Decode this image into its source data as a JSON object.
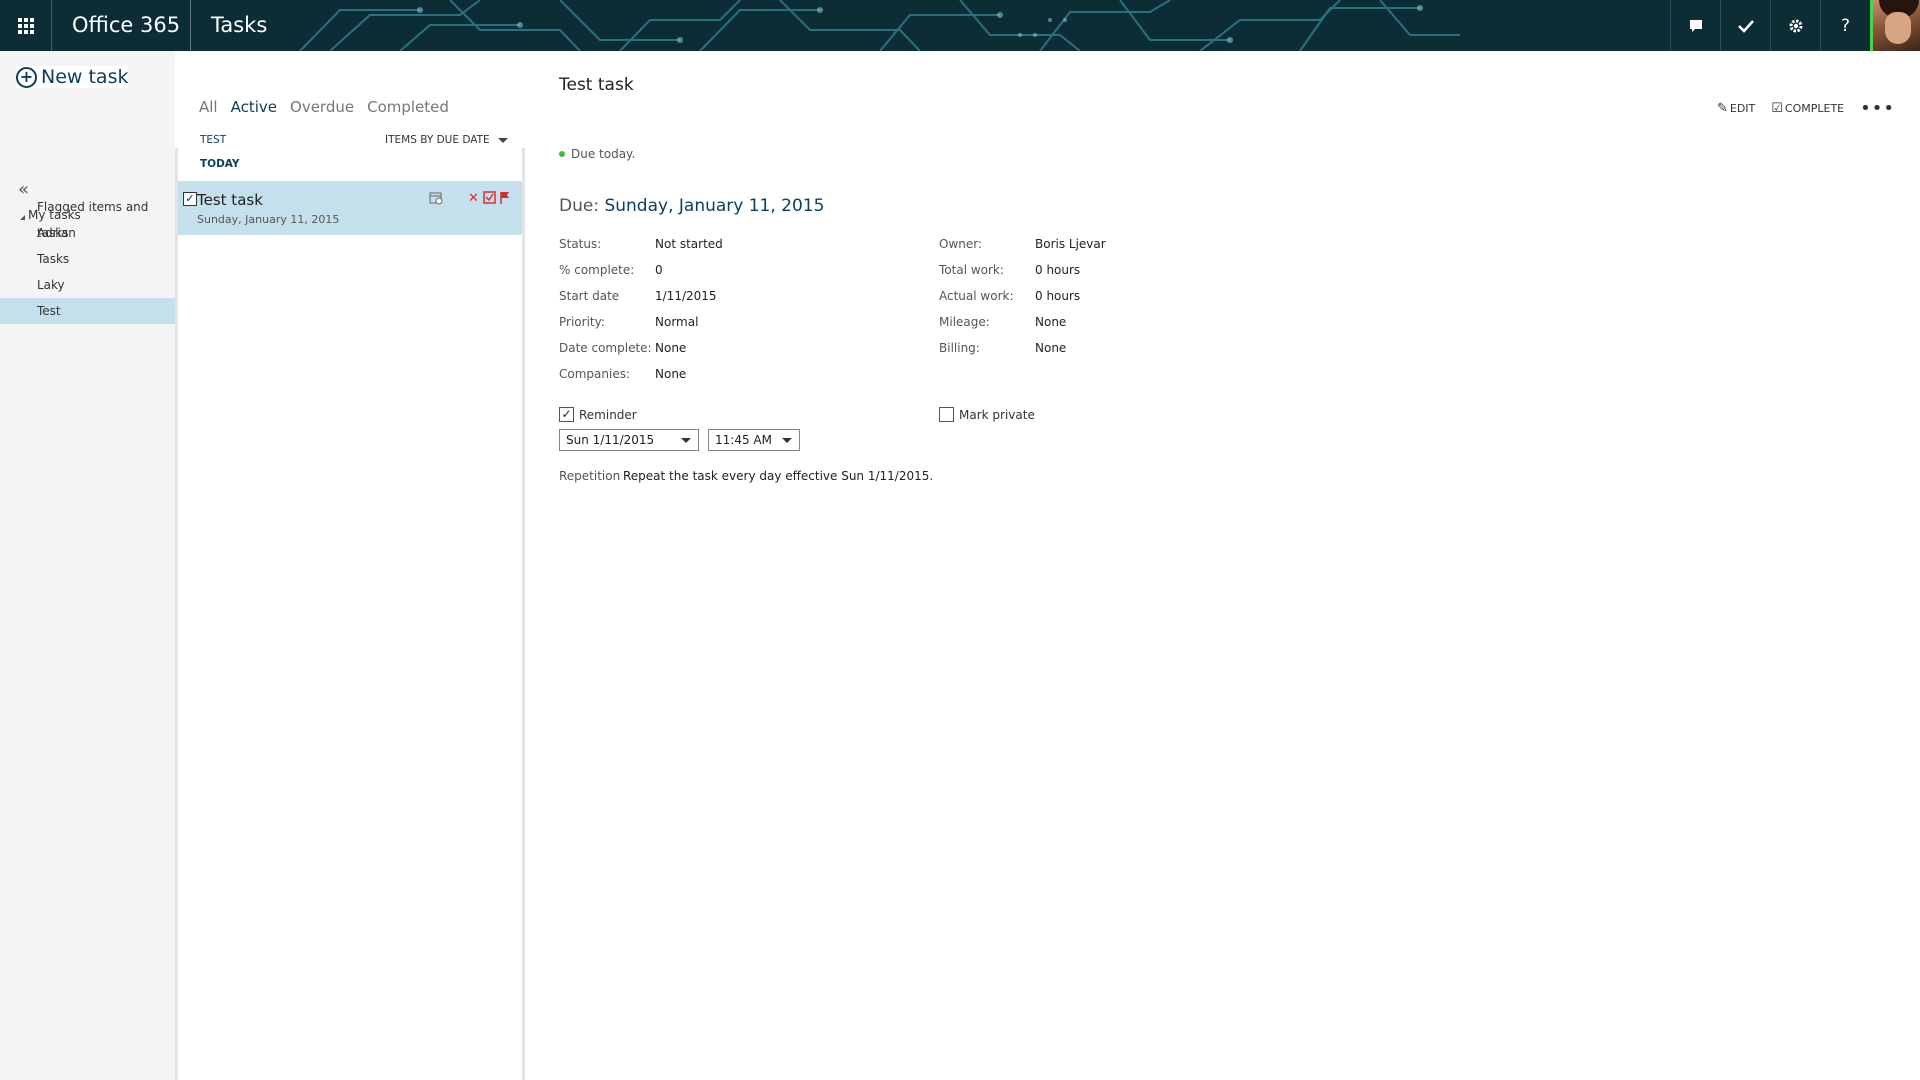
{
  "topbar": {
    "brand": "Office 365",
    "app": "Tasks",
    "icons": [
      "waffle-icon",
      "chat-icon",
      "checkmark-icon",
      "gear-icon",
      "help-icon"
    ],
    "help_glyph": "?",
    "accent": "#0d2d36"
  },
  "nav": {
    "new_task": "New task",
    "collapse_glyph": "«",
    "my_tasks": "My tasks",
    "items": [
      {
        "label": "Flagged items and tasks"
      },
      {
        "label": "Adrian"
      },
      {
        "label": "Tasks"
      },
      {
        "label": "Laky"
      },
      {
        "label": "Test"
      }
    ],
    "selected": "Test"
  },
  "list": {
    "filters": [
      "All",
      "Active",
      "Overdue",
      "Completed"
    ],
    "active_filter": "Active",
    "folder": "TEST",
    "sort": "ITEMS BY DUE DATE",
    "group": "TODAY",
    "tasks": [
      {
        "title": "Test task",
        "date": "Sunday, January 11, 2015"
      }
    ],
    "selection_color": "#c4e0ec"
  },
  "detail": {
    "title": "Test task",
    "edit": "EDIT",
    "complete": "COMPLETE",
    "due_notice": "Due today.",
    "due_label": "Due:",
    "due_value": "Sunday, January 11, 2015",
    "left_fields": [
      {
        "label": "Status:",
        "value": "Not started"
      },
      {
        "label": "% complete:",
        "value": "0"
      },
      {
        "label": "Start date",
        "value": "1/11/2015"
      },
      {
        "label": "Priority:",
        "value": "Normal"
      },
      {
        "label": "Date complete:",
        "value": "None"
      },
      {
        "label": "Companies:",
        "value": "None"
      }
    ],
    "right_fields": [
      {
        "label": "Owner:",
        "value": "Boris Ljevar"
      },
      {
        "label": "Total work:",
        "value": "0 hours"
      },
      {
        "label": "Actual work:",
        "value": "0 hours"
      },
      {
        "label": "Mileage:",
        "value": "None"
      },
      {
        "label": "Billing:",
        "value": "None"
      }
    ],
    "reminder_label": "Reminder",
    "reminder_checked": true,
    "reminder_date": "Sun 1/11/2015",
    "reminder_time": "11:45 AM",
    "mark_private_label": "Mark private",
    "mark_private_checked": false,
    "repetition_label": "Repetition",
    "repetition_value": "Repeat the task every day effective Sun 1/11/2015."
  }
}
